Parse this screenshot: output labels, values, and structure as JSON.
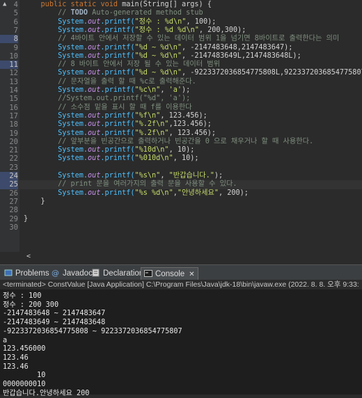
{
  "editor": {
    "lines": [
      {
        "n": "4",
        "hl": false,
        "parts": [
          {
            "t": "    ",
            "c": ""
          },
          {
            "t": "public",
            "c": "kw"
          },
          {
            "t": " ",
            "c": ""
          },
          {
            "t": "static",
            "c": "kw"
          },
          {
            "t": " ",
            "c": ""
          },
          {
            "t": "void",
            "c": "kw"
          },
          {
            "t": " main(String[] args) {",
            "c": ""
          }
        ]
      },
      {
        "n": "5",
        "hl": false,
        "parts": [
          {
            "t": "        ",
            "c": ""
          },
          {
            "t": "// ",
            "c": "cm"
          },
          {
            "t": "TODO",
            "c": "todo"
          },
          {
            "t": " Auto-generated method stub",
            "c": "cm"
          }
        ]
      },
      {
        "n": "6",
        "hl": false,
        "parts": [
          {
            "t": "        ",
            "c": ""
          },
          {
            "t": "System.",
            "c": "id"
          },
          {
            "t": "out",
            "c": "fld"
          },
          {
            "t": ".printf(",
            "c": "id"
          },
          {
            "t": "\"정수 : %d\\n\"",
            "c": "str"
          },
          {
            "t": ", 100);",
            "c": ""
          }
        ]
      },
      {
        "n": "7",
        "hl": false,
        "parts": [
          {
            "t": "        ",
            "c": ""
          },
          {
            "t": "System.",
            "c": "id"
          },
          {
            "t": "out",
            "c": "fld"
          },
          {
            "t": ".printf(",
            "c": "id"
          },
          {
            "t": "\"정수 : %d %d\\n\"",
            "c": "str"
          },
          {
            "t": ", 200,300);",
            "c": ""
          }
        ]
      },
      {
        "n": "8",
        "hl": true,
        "parts": [
          {
            "t": "        ",
            "c": ""
          },
          {
            "t": "// 4바이트 안에서 저장할 수 있는 데이터 범위 1을 넘기면 8바이트로 출력한다는 의미",
            "c": "cm"
          }
        ]
      },
      {
        "n": "9",
        "hl": false,
        "parts": [
          {
            "t": "        ",
            "c": ""
          },
          {
            "t": "System.",
            "c": "id"
          },
          {
            "t": "out",
            "c": "fld"
          },
          {
            "t": ".printf(",
            "c": "id"
          },
          {
            "t": "\"%d ~ %d\\n\"",
            "c": "str"
          },
          {
            "t": ", -2147483648,2147483647);",
            "c": ""
          }
        ]
      },
      {
        "n": "10",
        "hl": false,
        "parts": [
          {
            "t": "        ",
            "c": ""
          },
          {
            "t": "System.",
            "c": "id"
          },
          {
            "t": "out",
            "c": "fld"
          },
          {
            "t": ".printf(",
            "c": "id"
          },
          {
            "t": "\"%d ~ %d\\n\"",
            "c": "str"
          },
          {
            "t": ", -2147483649L,2147483648L);",
            "c": ""
          }
        ]
      },
      {
        "n": "11",
        "hl": true,
        "parts": [
          {
            "t": "        ",
            "c": ""
          },
          {
            "t": "// 8 바이트 안에서 저장 될 수 있는 데이터 범위",
            "c": "cm"
          }
        ]
      },
      {
        "n": "12",
        "hl": false,
        "parts": [
          {
            "t": "        ",
            "c": ""
          },
          {
            "t": "System.",
            "c": "id"
          },
          {
            "t": "out",
            "c": "fld"
          },
          {
            "t": ".printf(",
            "c": "id"
          },
          {
            "t": "\"%d ~ %d\\n\"",
            "c": "str"
          },
          {
            "t": ", -9223372036854775808L,9223372036854775807L);",
            "c": ""
          }
        ]
      },
      {
        "n": "13",
        "hl": false,
        "parts": [
          {
            "t": "        ",
            "c": ""
          },
          {
            "t": "// 문자열을 출력 할 때 %c로 출력해준다.",
            "c": "cm"
          }
        ]
      },
      {
        "n": "14",
        "hl": false,
        "parts": [
          {
            "t": "        ",
            "c": ""
          },
          {
            "t": "System.",
            "c": "id"
          },
          {
            "t": "out",
            "c": "fld"
          },
          {
            "t": ".printf(",
            "c": "id"
          },
          {
            "t": "\"%c\\n\"",
            "c": "str"
          },
          {
            "t": ", ",
            "c": ""
          },
          {
            "t": "'a'",
            "c": "str"
          },
          {
            "t": ");",
            "c": ""
          }
        ]
      },
      {
        "n": "15",
        "hl": false,
        "parts": [
          {
            "t": "        ",
            "c": ""
          },
          {
            "t": "//System.out.printf(\"%d\", 'a');",
            "c": "cm"
          }
        ]
      },
      {
        "n": "16",
        "hl": false,
        "parts": [
          {
            "t": "        ",
            "c": ""
          },
          {
            "t": "// 소수점 밑을 표시 할 때 f를 이용한다",
            "c": "cm"
          }
        ]
      },
      {
        "n": "17",
        "hl": false,
        "parts": [
          {
            "t": "        ",
            "c": ""
          },
          {
            "t": "System.",
            "c": "id"
          },
          {
            "t": "out",
            "c": "fld"
          },
          {
            "t": ".printf(",
            "c": "id"
          },
          {
            "t": "\"%f\\n\"",
            "c": "str"
          },
          {
            "t": ", 123.456);",
            "c": ""
          }
        ]
      },
      {
        "n": "18",
        "hl": false,
        "parts": [
          {
            "t": "        ",
            "c": ""
          },
          {
            "t": "System.",
            "c": "id"
          },
          {
            "t": "out",
            "c": "fld"
          },
          {
            "t": ".printf(",
            "c": "id"
          },
          {
            "t": "\"%.2f\\n\"",
            "c": "str"
          },
          {
            "t": ",123.456);",
            "c": ""
          }
        ]
      },
      {
        "n": "19",
        "hl": false,
        "parts": [
          {
            "t": "        ",
            "c": ""
          },
          {
            "t": "System.",
            "c": "id"
          },
          {
            "t": "out",
            "c": "fld"
          },
          {
            "t": ".printf(",
            "c": "id"
          },
          {
            "t": "\"%.2f\\n\"",
            "c": "str"
          },
          {
            "t": ", 123.456);",
            "c": ""
          }
        ]
      },
      {
        "n": "20",
        "hl": false,
        "parts": [
          {
            "t": "        ",
            "c": ""
          },
          {
            "t": "// 앞부분을 빈공간으로 출력하거나 빈공간을 0 으로 채우거나 할 때 사용한다.",
            "c": "cm"
          }
        ]
      },
      {
        "n": "21",
        "hl": false,
        "parts": [
          {
            "t": "        ",
            "c": ""
          },
          {
            "t": "System.",
            "c": "id"
          },
          {
            "t": "out",
            "c": "fld"
          },
          {
            "t": ".printf(",
            "c": "id"
          },
          {
            "t": "\"%10d\\n\"",
            "c": "str"
          },
          {
            "t": ", 10);",
            "c": ""
          }
        ]
      },
      {
        "n": "22",
        "hl": false,
        "parts": [
          {
            "t": "        ",
            "c": ""
          },
          {
            "t": "System.",
            "c": "id"
          },
          {
            "t": "out",
            "c": "fld"
          },
          {
            "t": ".printf(",
            "c": "id"
          },
          {
            "t": "\"%010d\\n\"",
            "c": "str"
          },
          {
            "t": ", 10);",
            "c": ""
          }
        ]
      },
      {
        "n": "23",
        "hl": false,
        "parts": [
          {
            "t": "",
            "c": ""
          }
        ]
      },
      {
        "n": "24",
        "hl": true,
        "parts": [
          {
            "t": "        ",
            "c": ""
          },
          {
            "t": "System.",
            "c": "id"
          },
          {
            "t": "out",
            "c": "fld"
          },
          {
            "t": ".printf(",
            "c": "id"
          },
          {
            "t": "\"%s\\n\"",
            "c": "str"
          },
          {
            "t": ", ",
            "c": ""
          },
          {
            "t": "\"반갑습니다.\"",
            "c": "str"
          },
          {
            "t": ");",
            "c": ""
          }
        ]
      },
      {
        "n": "25",
        "hl": true,
        "cur": true,
        "parts": [
          {
            "t": "        ",
            "c": ""
          },
          {
            "t": "// print 문을 여러가지의 출력 문을 사용할 수 있다.",
            "c": "cm"
          }
        ]
      },
      {
        "n": "26",
        "hl": false,
        "parts": [
          {
            "t": "        ",
            "c": ""
          },
          {
            "t": "System.",
            "c": "id"
          },
          {
            "t": "out",
            "c": "fld"
          },
          {
            "t": ".printf(",
            "c": "id"
          },
          {
            "t": "\"%s %d\\n\"",
            "c": "str"
          },
          {
            "t": ",",
            "c": ""
          },
          {
            "t": "\"안녕하세요\"",
            "c": "str"
          },
          {
            "t": ", 200);",
            "c": ""
          }
        ]
      },
      {
        "n": "27",
        "hl": false,
        "parts": [
          {
            "t": "    }",
            "c": ""
          }
        ]
      },
      {
        "n": "28",
        "hl": false,
        "parts": [
          {
            "t": "",
            "c": ""
          }
        ]
      },
      {
        "n": "29",
        "hl": false,
        "parts": [
          {
            "t": "}",
            "c": ""
          }
        ]
      },
      {
        "n": "30",
        "hl": false,
        "parts": [
          {
            "t": "",
            "c": ""
          }
        ]
      }
    ],
    "override_marker": "▲",
    "scroll_left": "<"
  },
  "tabs": [
    {
      "label": "Problems",
      "icon": "problems-icon",
      "active": false
    },
    {
      "label": "Javadoc",
      "icon": "javadoc-icon",
      "active": false
    },
    {
      "label": "Declaration",
      "icon": "declaration-icon",
      "active": false
    },
    {
      "label": "Console",
      "icon": "console-icon",
      "active": true
    }
  ],
  "console_tab_close": "✕",
  "status_line": "<terminated> ConstValue [Java Application] C:\\Program Files\\Java\\jdk-18\\bin\\javaw.exe  (2022. 8. 8. 오후 9:33:",
  "console_output": [
    "정수 : 100",
    "정수 : 200 300",
    "-2147483648 ~ 2147483647",
    "-2147483649 ~ 2147483648",
    "-9223372036854775808 ~ 9223372036854775807",
    "a",
    "123.456000",
    "123.46",
    "123.46",
    "        10",
    "0000000010",
    "반갑습니다.안녕하세요 200"
  ]
}
